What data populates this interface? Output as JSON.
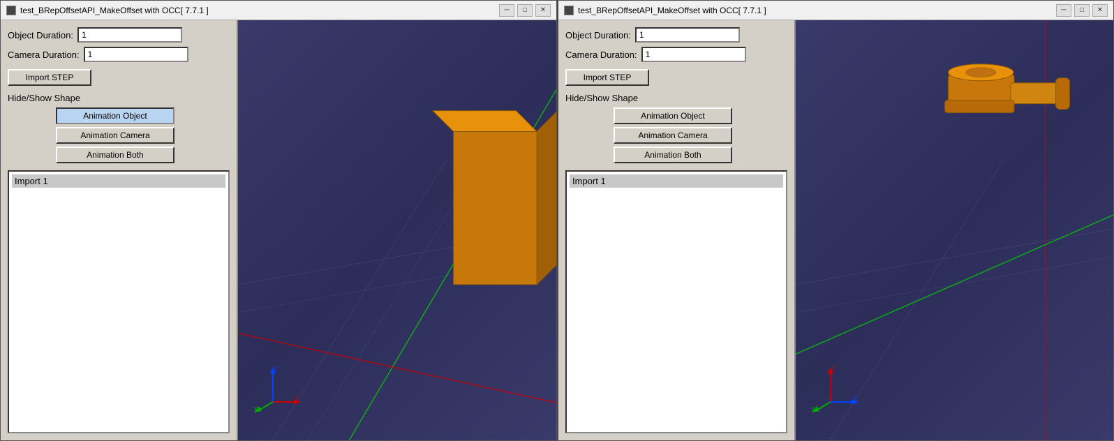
{
  "windows": [
    {
      "id": "window-left",
      "title": "test_BRepOffsetAPI_MakeOffset with OCC[ 7.7.1 ]",
      "controls": {
        "object_duration_label": "Object Duration:",
        "object_duration_value": "1",
        "camera_duration_label": "Camera Duration:",
        "camera_duration_value": "1",
        "import_step_label": "Import STEP",
        "hide_show_label": "Hide/Show Shape",
        "animation_object_label": "Animation Object",
        "animation_camera_label": "Animation Camera",
        "animation_both_label": "Animation Both",
        "import_list_header": "Import 1"
      },
      "active_animation": "object"
    },
    {
      "id": "window-right",
      "title": "test_BRepOffsetAPI_MakeOffset with OCC[ 7.7.1 ]",
      "controls": {
        "object_duration_label": "Object Duration:",
        "object_duration_value": "1",
        "camera_duration_label": "Camera Duration:",
        "camera_duration_value": "1",
        "import_step_label": "Import STEP",
        "hide_show_label": "Hide/Show Shape",
        "animation_object_label": "Animation Object",
        "animation_camera_label": "Animation Camera",
        "animation_both_label": "Animation Both",
        "import_list_header": "Import 1"
      },
      "active_animation": "none"
    }
  ],
  "win_buttons": {
    "minimize": "─",
    "maximize": "□",
    "close": "✕"
  }
}
